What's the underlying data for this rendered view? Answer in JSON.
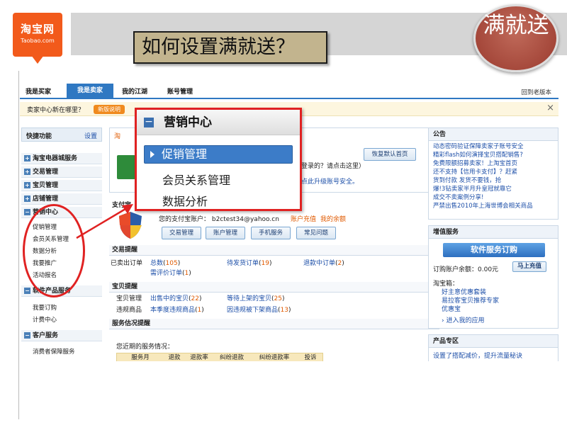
{
  "slide": {
    "title": "如何设置满就送？",
    "badge": "满就送",
    "logo_main": "淘宝网",
    "logo_sub": "Taobao.com"
  },
  "nav": {
    "tabs": [
      "我是买家",
      "我是卖家",
      "我的江湖",
      "账号管理"
    ],
    "active": "我是卖家",
    "right_link": "回到老版本"
  },
  "notice": {
    "text": "卖家中心新在哪里？",
    "button": "新版说明",
    "close": "×"
  },
  "sidebar": {
    "header": "快捷功能",
    "setting": "设置",
    "sections": [
      "淘宝电器城服务",
      "交易管理",
      "宝贝管理",
      "店铺管理",
      "营销中心"
    ],
    "marketing_items": [
      "促销管理",
      "会员关系管理",
      "数据分析",
      "我要推广",
      "活动报名"
    ],
    "software_section": "软件产品服务",
    "software_items": [
      "我要订购",
      "计费中心"
    ],
    "customer_section": "客户服务",
    "customer_items": [
      "消费者保障服务"
    ]
  },
  "main": {
    "alert_prefix": "淘",
    "restore_button": "恢复默认首页",
    "login_text": "登录的？请点击这里）",
    "upgrade_text": "点此升级账号安全。",
    "pay_label": "支付宝",
    "account_text": "您的支付宝账户： b2ctest34@yahoo.cn",
    "recharge": "账户充值",
    "balance": "我的余额",
    "action_buttons": [
      "交易管理",
      "账户管理",
      "手机服务",
      "常见问题"
    ],
    "trade": {
      "header": "交易提醒",
      "sold_label": "已卖出订单",
      "items": [
        {
          "label": "总数",
          "count": "105"
        },
        {
          "label": "待发货订单",
          "count": "19"
        },
        {
          "label": "退款中订单",
          "count": "2"
        },
        {
          "label": "需评价订单",
          "count": "1"
        }
      ]
    },
    "goods": {
      "header": "宝贝提醒",
      "manage_label": "宝贝管理",
      "violation_label": "违规商品",
      "items": [
        {
          "label": "出售中的宝贝",
          "count": "22"
        },
        {
          "label": "等待上架的宝贝",
          "count": "25"
        },
        {
          "label": "本季度违规商品",
          "count": "1"
        },
        {
          "label": "因违规被下架商品",
          "count": "13"
        }
      ]
    },
    "service": {
      "header": "服务估况提醒",
      "text": "您近期的服务情况：",
      "columns": [
        "服务月",
        "退款",
        "退款率",
        "纠纷退款",
        "纠纷退款率",
        "投诉"
      ]
    }
  },
  "right": {
    "notice_title": "公告",
    "notices": [
      "动态密码验证保障卖家子账号安全",
      "精彩flash如何演择宝贝搭配销售?",
      "免费限额招募卖家！上淘宝首页",
      "还不支持【信用卡支付】？赶紧",
      "货到付款 发货不要钱，抢",
      "爆!3钻卖家半月升皇冠就靠它",
      "成交不卖案例分享!",
      "严禁出售2010年上海世博会相关商品"
    ],
    "value_title": "增值服务",
    "subscribe_button": "软件服务订购",
    "balance_text": "订购账户余额：0.00元",
    "recharge_button": "马上充值",
    "treasure_label": "淘宝箱：",
    "treasure_items": [
      "好主意优惠套装",
      "易拉客宝贝推荐专家",
      "优惠宝"
    ],
    "enter_apps": "› 进入我的应用",
    "product_title": "产品专区",
    "product_text": "设置了搭配减价，提升流量秘诀"
  },
  "popup": {
    "title": "营销中心",
    "items": [
      "促销管理",
      "会员关系管理",
      "数据分析"
    ],
    "selected": "促销管理"
  }
}
